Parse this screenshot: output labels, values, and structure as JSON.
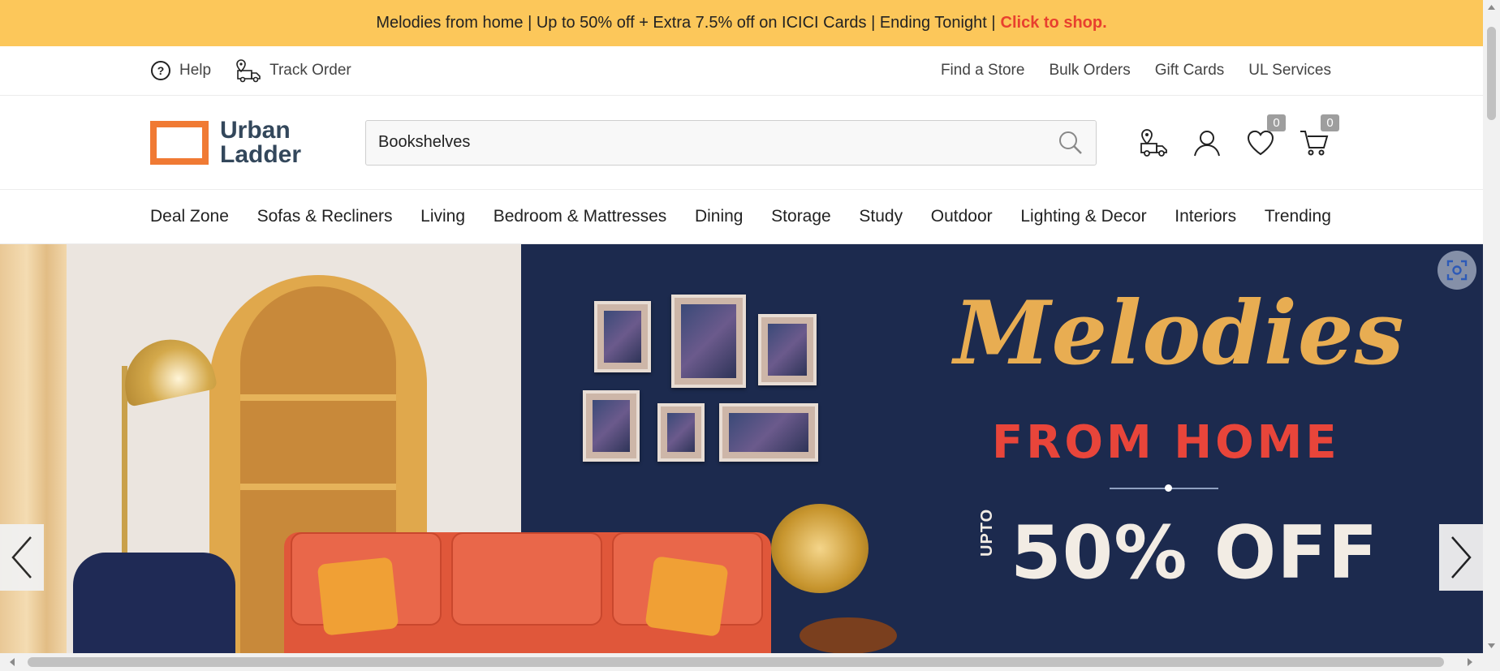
{
  "promo": {
    "text": "Melodies from home | Up to 50% off + Extra 7.5% off on ICICI Cards | Ending Tonight |",
    "link": "Click to shop."
  },
  "util": {
    "help": "Help",
    "track": "Track Order",
    "right": [
      "Find a Store",
      "Bulk Orders",
      "Gift Cards",
      "UL Services"
    ]
  },
  "header": {
    "logo_line1": "Urban",
    "logo_line2": "Ladder",
    "search_value": "Bookshelves",
    "wishlist_count": "0",
    "cart_count": "0"
  },
  "nav": [
    "Deal Zone",
    "Sofas & Recliners",
    "Living",
    "Bedroom & Mattresses",
    "Dining",
    "Storage",
    "Study",
    "Outdoor",
    "Lighting & Decor",
    "Interiors",
    "Trending"
  ],
  "hero": {
    "title": "Melodies",
    "subtitle": "FROM HOME",
    "upto": "UPTO",
    "offer": "50% OFF"
  },
  "colors": {
    "promo_bg": "#fcc75a",
    "promo_link": "#e8402e",
    "logo_orange": "#f07a34",
    "logo_text": "#33475b",
    "hero_navy": "#1c2a4e"
  }
}
